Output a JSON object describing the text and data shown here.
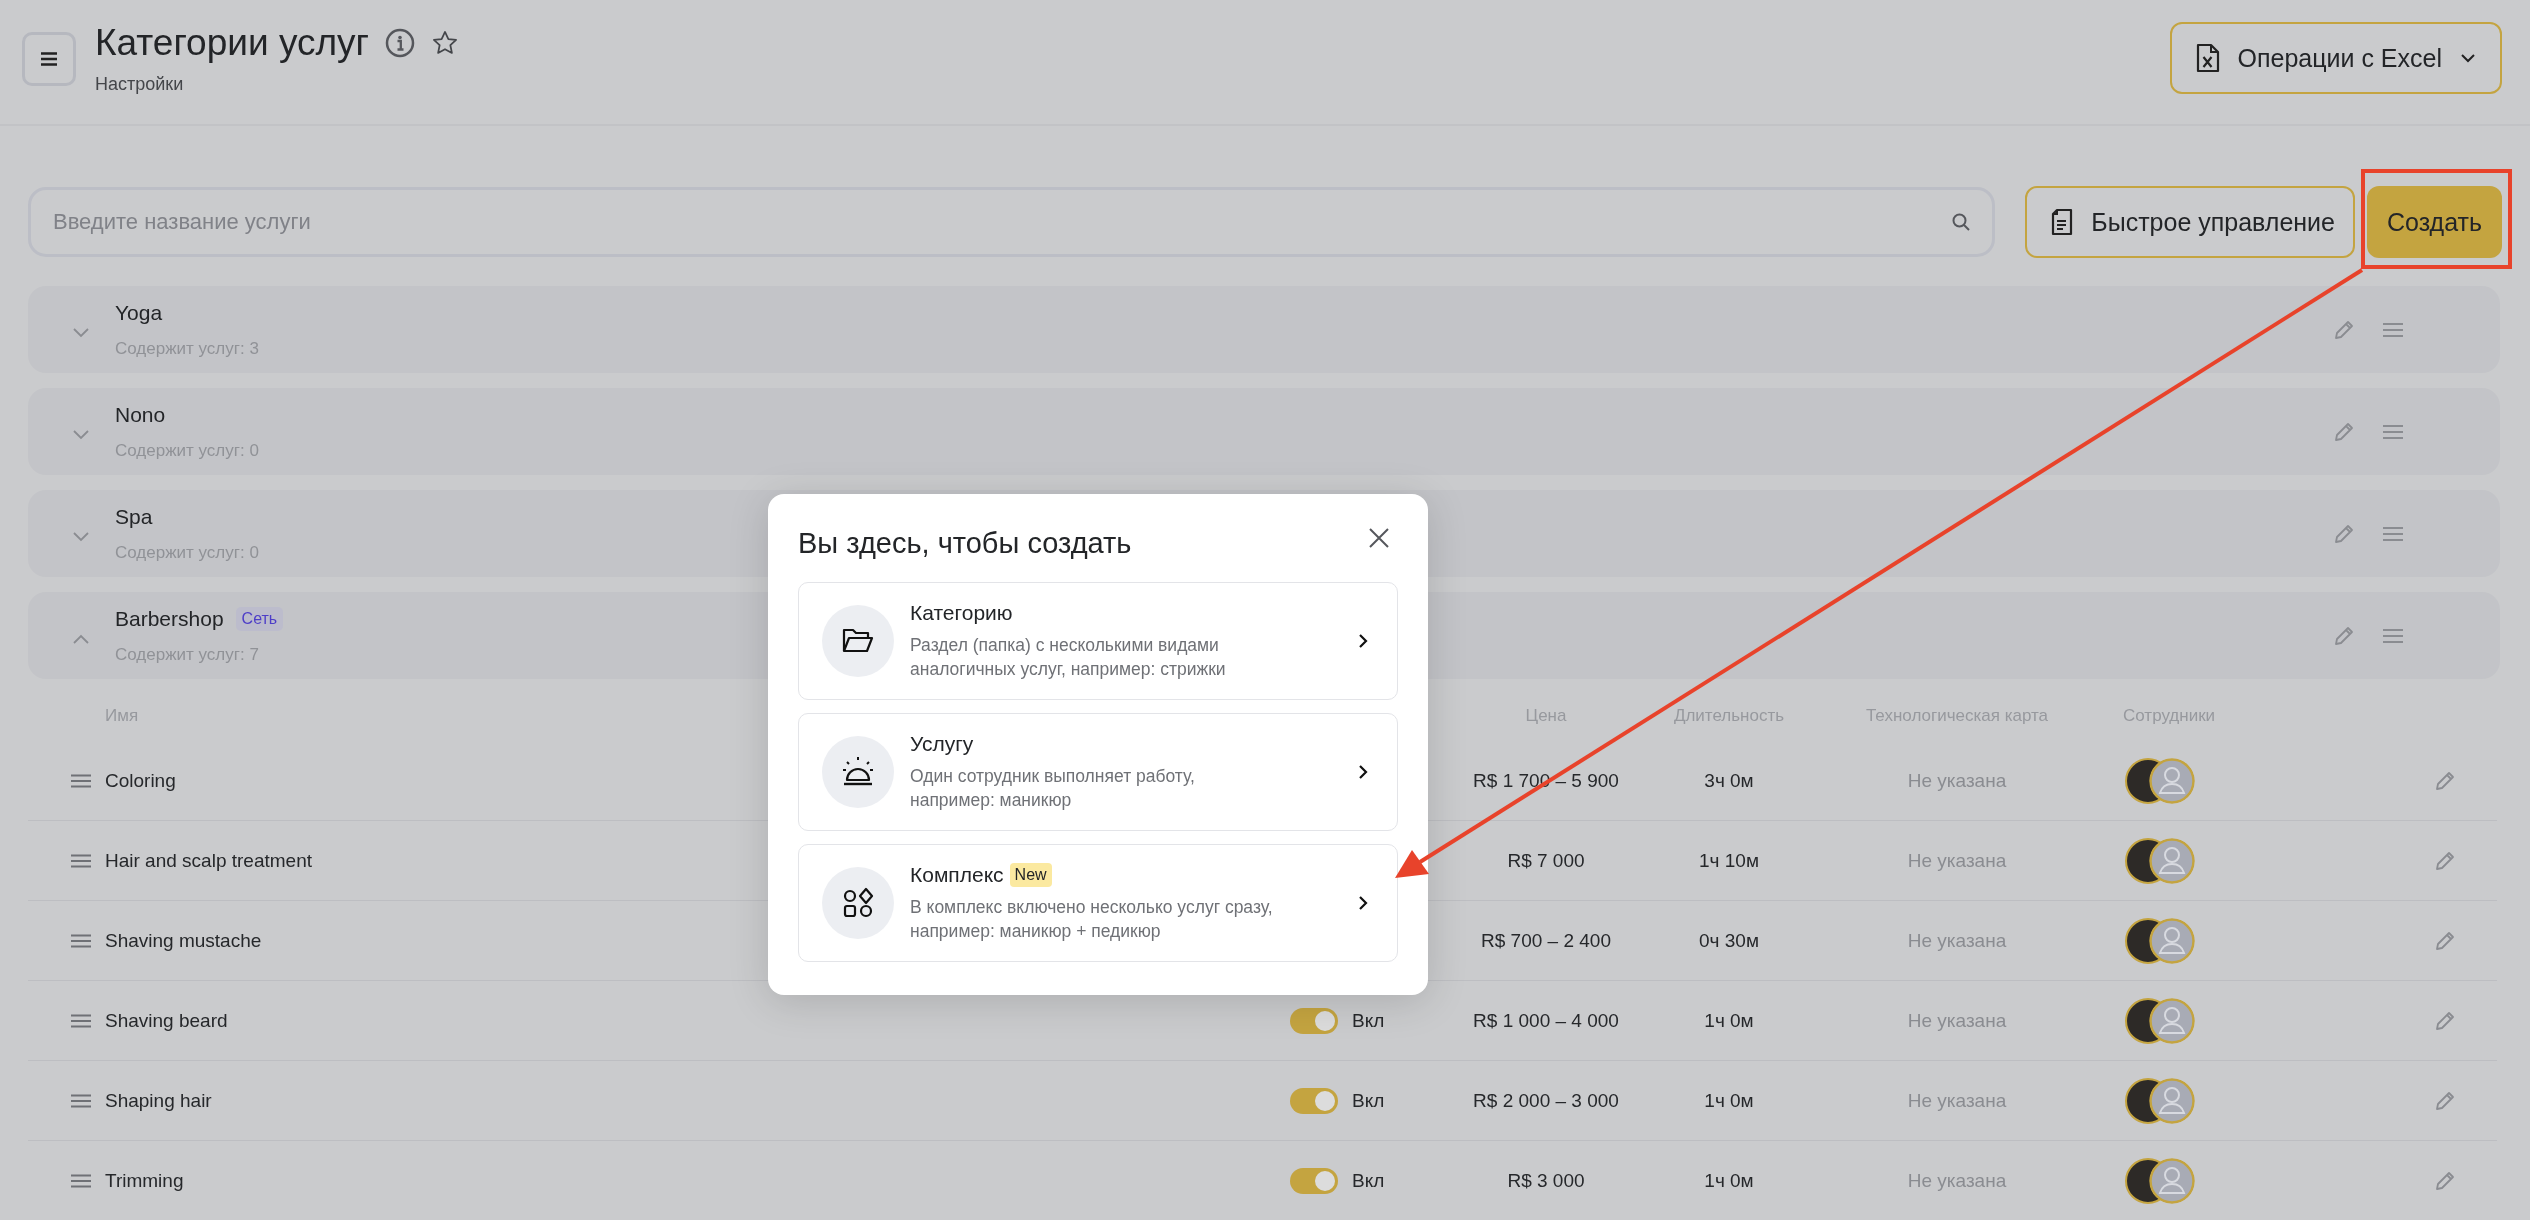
{
  "header": {
    "title": "Категории услуг",
    "subtitle": "Настройки",
    "excel_button": "Операции с Excel"
  },
  "search": {
    "placeholder": "Введите название услуги"
  },
  "actions": {
    "quick_manage": "Быстрое управление",
    "create": "Создать"
  },
  "categories": [
    {
      "name": "Yoga",
      "count": "Содержит услуг: 3",
      "expanded": false
    },
    {
      "name": "Nono",
      "count": "Содержит услуг: 0",
      "expanded": false
    },
    {
      "name": "Spa",
      "count": "Содержит услуг: 0",
      "expanded": false
    },
    {
      "name": "Barbershop",
      "badge": "Сеть",
      "count": "Содержит услуг: 7",
      "expanded": true
    }
  ],
  "table": {
    "columns": {
      "name": "Имя",
      "price": "Цена",
      "duration": "Длительность",
      "tech_card": "Технологическая карта",
      "staff": "Сотрудники"
    },
    "rows": [
      {
        "name": "Coloring",
        "price": "R$ 1 700 – 5 900",
        "duration": "3ч 0м",
        "tech_card": "Не указана",
        "staff": [
          {
            "kind": "photo"
          },
          {
            "kind": "placeholder"
          }
        ]
      },
      {
        "name": "Hair and scalp treatment",
        "price": "R$ 7 000",
        "duration": "1ч 10м",
        "tech_card": "Не указана",
        "staff": [
          {
            "kind": "photo"
          },
          {
            "kind": "placeholder"
          }
        ]
      },
      {
        "name": "Shaving mustache",
        "price": "R$ 700 – 2 400",
        "duration": "0ч 30м",
        "tech_card": "Не указана",
        "staff": [
          {
            "kind": "photo"
          },
          {
            "kind": "placeholder"
          }
        ]
      },
      {
        "name": "Shaving beard",
        "status": {
          "on": true,
          "label": "Вкл"
        },
        "price": "R$ 1 000 – 4 000",
        "duration": "1ч 0м",
        "tech_card": "Не указана",
        "staff": [
          {
            "kind": "photo"
          },
          {
            "kind": "placeholder"
          }
        ]
      },
      {
        "name": "Shaping hair",
        "status": {
          "on": true,
          "label": "Вкл"
        },
        "price": "R$ 2 000 – 3 000",
        "duration": "1ч 0м",
        "tech_card": "Не указана",
        "staff": [
          {
            "kind": "photo"
          },
          {
            "kind": "placeholder"
          }
        ]
      },
      {
        "name": "Trimming",
        "status": {
          "on": true,
          "label": "Вкл"
        },
        "price": "R$ 3 000",
        "duration": "1ч 0м",
        "tech_card": "Не указана",
        "staff": [
          {
            "kind": "photo"
          },
          {
            "kind": "placeholder"
          }
        ]
      }
    ]
  },
  "modal": {
    "title": "Вы здесь, чтобы создать",
    "options": [
      {
        "kind": "folder",
        "title": "Категорию",
        "description": "Раздел (папка) с несколькими видами\nаналогичных услуг, например: стрижки"
      },
      {
        "kind": "bell",
        "title": "Услугу",
        "description": "Один сотрудник выполняет работу,\nнапример: маникюр"
      },
      {
        "kind": "shapes",
        "title": "Комплекс",
        "badge": "New",
        "description": "В комплекс включено несколько услуг сразу,\nнапример: маникюр + педикюр"
      }
    ]
  }
}
